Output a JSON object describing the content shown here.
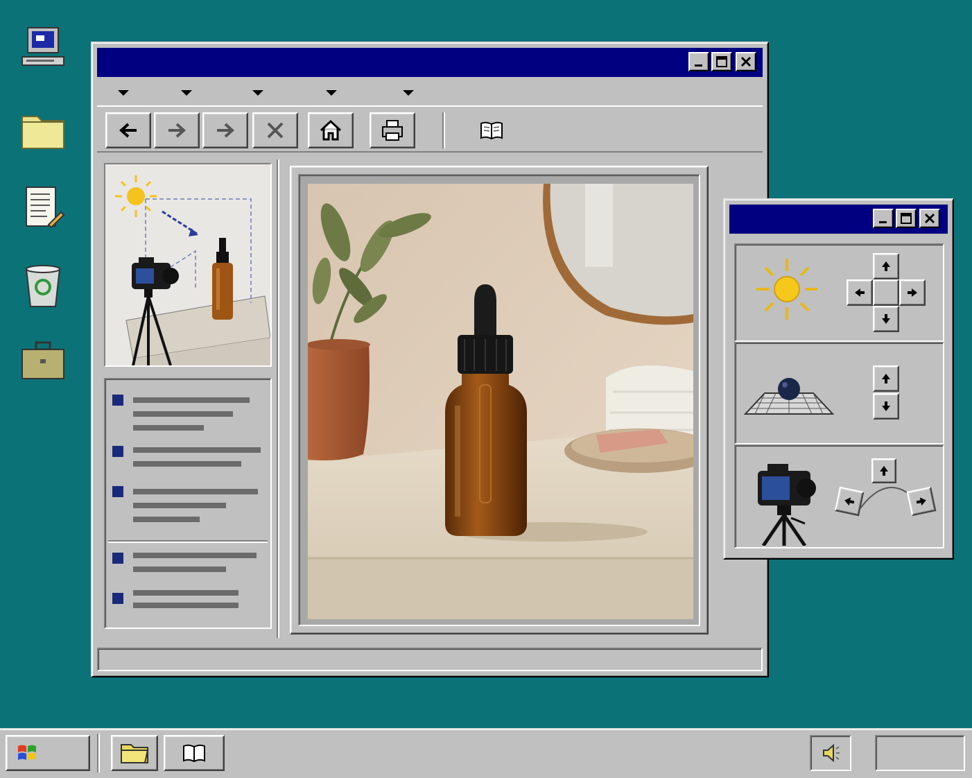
{
  "desktop": {
    "icons": [
      {
        "name": "my-computer-icon"
      },
      {
        "name": "folder-icon"
      },
      {
        "name": "notepad-icon"
      },
      {
        "name": "recycle-bin-icon"
      },
      {
        "name": "briefcase-icon"
      }
    ]
  },
  "main_window": {
    "title": "",
    "menus": [
      "",
      "",
      "",
      "",
      ""
    ],
    "toolbar": [
      "back-icon",
      "forward-icon",
      "forward-alt-icon",
      "stop-icon",
      "home-icon",
      "print-icon",
      "book-icon"
    ],
    "status_text": ""
  },
  "float_window": {
    "title": "",
    "panels": [
      "light-control",
      "object-control",
      "camera-control"
    ]
  },
  "taskbar": {
    "start_label": "",
    "tray_clock": "",
    "items": [
      "folder-icon",
      "book-icon"
    ]
  },
  "colors": {
    "desktop": "#0b7277",
    "titlebar": "#000080",
    "face": "#c0c0c0",
    "bullet": "#1a2a7a"
  }
}
